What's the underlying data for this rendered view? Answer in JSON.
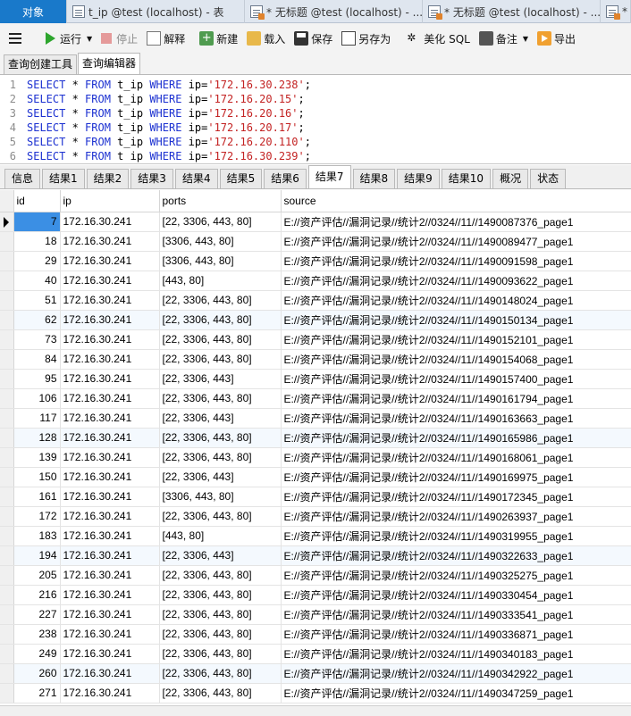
{
  "doc_tabs": [
    {
      "label": "对象",
      "icon": "none",
      "active": true
    },
    {
      "label": "t_ip @test (localhost) - 表",
      "icon": "table-icon"
    },
    {
      "label": "* 无标题 @test (localhost) - ...",
      "icon": "query-icon"
    },
    {
      "label": "* 无标题 @test (localhost) - ...",
      "icon": "query-icon"
    },
    {
      "label": "*",
      "icon": "query-icon"
    }
  ],
  "toolbar": {
    "run": "运行",
    "stop": "停止",
    "explain": "解释",
    "new": "新建",
    "load": "载入",
    "save": "保存",
    "save_as": "另存为",
    "beautify": "美化 SQL",
    "note": "备注",
    "export": "导出"
  },
  "sub_tabs": [
    "查询创建工具",
    "查询编辑器"
  ],
  "editor": {
    "lines": [
      {
        "no": "1",
        "k1": "SELECT",
        "star": " * ",
        "k2": "FROM",
        "table": " t_ip ",
        "k3": "WHERE",
        "col": " ip=",
        "val": "'172.16.30.238'",
        "end": ";"
      },
      {
        "no": "2",
        "k1": "SELECT",
        "star": " * ",
        "k2": "FROM",
        "table": " t_ip ",
        "k3": "WHERE",
        "col": " ip=",
        "val": "'172.16.20.15'",
        "end": ";"
      },
      {
        "no": "3",
        "k1": "SELECT",
        "star": " * ",
        "k2": "FROM",
        "table": " t_ip ",
        "k3": "WHERE",
        "col": " ip=",
        "val": "'172.16.20.16'",
        "end": ";"
      },
      {
        "no": "4",
        "k1": "SELECT",
        "star": " * ",
        "k2": "FROM",
        "table": " t_ip ",
        "k3": "WHERE",
        "col": " ip=",
        "val": "'172.16.20.17'",
        "end": ";"
      },
      {
        "no": "5",
        "k1": "SELECT",
        "star": " * ",
        "k2": "FROM",
        "table": " t_ip ",
        "k3": "WHERE",
        "col": " ip=",
        "val": "'172.16.20.110'",
        "end": ";"
      },
      {
        "no": "6",
        "k1": "SELECT",
        "star": " * ",
        "k2": "FROM",
        "table": " t ip ",
        "k3": "WHERE",
        "col": " ip=",
        "val": "'172.16.30.239'",
        "end": ";"
      }
    ]
  },
  "result_tabs": [
    "信息",
    "结果1",
    "结果2",
    "结果3",
    "结果4",
    "结果5",
    "结果6",
    "结果7",
    "结果8",
    "结果9",
    "结果10",
    "概况",
    "状态"
  ],
  "active_result_tab": 7,
  "grid": {
    "columns": [
      "id",
      "ip",
      "ports",
      "source"
    ],
    "rows": [
      [
        "7",
        "172.16.30.241",
        "[22, 3306, 443, 80]",
        "E://资产评估//漏洞记录//统计2//0324//11//1490087376_page1"
      ],
      [
        "18",
        "172.16.30.241",
        "[3306, 443, 80]",
        "E://资产评估//漏洞记录//统计2//0324//11//1490089477_page1"
      ],
      [
        "29",
        "172.16.30.241",
        "[3306, 443, 80]",
        "E://资产评估//漏洞记录//统计2//0324//11//1490091598_page1"
      ],
      [
        "40",
        "172.16.30.241",
        "[443, 80]",
        "E://资产评估//漏洞记录//统计2//0324//11//1490093622_page1"
      ],
      [
        "51",
        "172.16.30.241",
        "[22, 3306, 443, 80]",
        "E://资产评估//漏洞记录//统计2//0324//11//1490148024_page1"
      ],
      [
        "62",
        "172.16.30.241",
        "[22, 3306, 443, 80]",
        "E://资产评估//漏洞记录//统计2//0324//11//1490150134_page1"
      ],
      [
        "73",
        "172.16.30.241",
        "[22, 3306, 443, 80]",
        "E://资产评估//漏洞记录//统计2//0324//11//1490152101_page1"
      ],
      [
        "84",
        "172.16.30.241",
        "[22, 3306, 443, 80]",
        "E://资产评估//漏洞记录//统计2//0324//11//1490154068_page1"
      ],
      [
        "95",
        "172.16.30.241",
        "[22, 3306, 443]",
        "E://资产评估//漏洞记录//统计2//0324//11//1490157400_page1"
      ],
      [
        "106",
        "172.16.30.241",
        "[22, 3306, 443, 80]",
        "E://资产评估//漏洞记录//统计2//0324//11//1490161794_page1"
      ],
      [
        "117",
        "172.16.30.241",
        "[22, 3306, 443]",
        "E://资产评估//漏洞记录//统计2//0324//11//1490163663_page1"
      ],
      [
        "128",
        "172.16.30.241",
        "[22, 3306, 443, 80]",
        "E://资产评估//漏洞记录//统计2//0324//11//1490165986_page1"
      ],
      [
        "139",
        "172.16.30.241",
        "[22, 3306, 443, 80]",
        "E://资产评估//漏洞记录//统计2//0324//11//1490168061_page1"
      ],
      [
        "150",
        "172.16.30.241",
        "[22, 3306, 443]",
        "E://资产评估//漏洞记录//统计2//0324//11//1490169975_page1"
      ],
      [
        "161",
        "172.16.30.241",
        "[3306, 443, 80]",
        "E://资产评估//漏洞记录//统计2//0324//11//1490172345_page1"
      ],
      [
        "172",
        "172.16.30.241",
        "[22, 3306, 443, 80]",
        "E://资产评估//漏洞记录//统计2//0324//11//1490263937_page1"
      ],
      [
        "183",
        "172.16.30.241",
        "[443, 80]",
        "E://资产评估//漏洞记录//统计2//0324//11//1490319955_page1"
      ],
      [
        "194",
        "172.16.30.241",
        "[22, 3306, 443]",
        "E://资产评估//漏洞记录//统计2//0324//11//1490322633_page1"
      ],
      [
        "205",
        "172.16.30.241",
        "[22, 3306, 443, 80]",
        "E://资产评估//漏洞记录//统计2//0324//11//1490325275_page1"
      ],
      [
        "216",
        "172.16.30.241",
        "[22, 3306, 443, 80]",
        "E://资产评估//漏洞记录//统计2//0324//11//1490330454_page1"
      ],
      [
        "227",
        "172.16.30.241",
        "[22, 3306, 443, 80]",
        "E://资产评估//漏洞记录//统计2//0324//11//1490333541_page1"
      ],
      [
        "238",
        "172.16.30.241",
        "[22, 3306, 443, 80]",
        "E://资产评估//漏洞记录//统计2//0324//11//1490336871_page1"
      ],
      [
        "249",
        "172.16.30.241",
        "[22, 3306, 443, 80]",
        "E://资产评估//漏洞记录//统计2//0324//11//1490340183_page1"
      ],
      [
        "260",
        "172.16.30.241",
        "[22, 3306, 443, 80]",
        "E://资产评估//漏洞记录//统计2//0324//11//1490342922_page1"
      ],
      [
        "271",
        "172.16.30.241",
        "[22, 3306, 443, 80]",
        "E://资产评估//漏洞记录//统计2//0324//11//1490347259_page1"
      ]
    ]
  },
  "colors": {
    "active_doc_tab": "#1979ca",
    "selected_cell": "#3b8fe4",
    "sql_keyword": "#1d32d1",
    "sql_string": "#c32323"
  }
}
